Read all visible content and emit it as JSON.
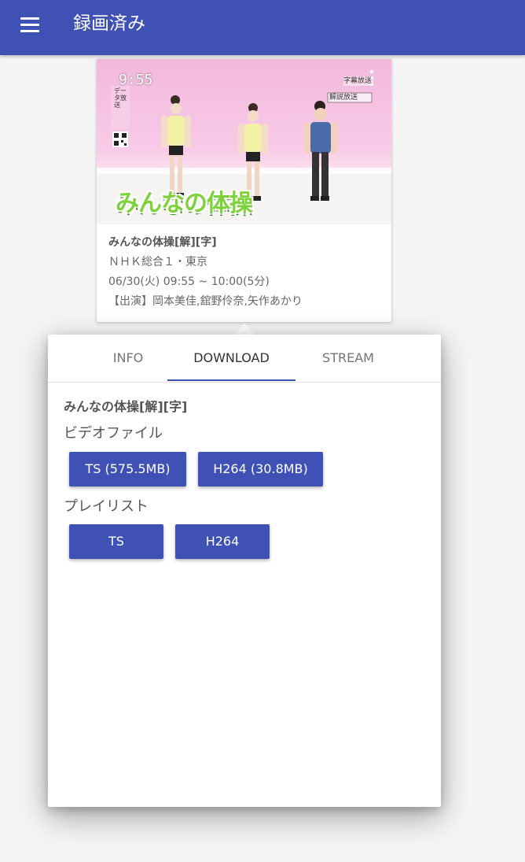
{
  "appbar": {
    "title": "録画済み",
    "menu_icon": "hamburger-menu-icon",
    "color": "#3f51b5"
  },
  "card": {
    "thumbnail": {
      "clock_text": "9:55",
      "logo_text": "みんなの体操",
      "badge_top": "字幕放送",
      "badge_bottom": "解説放送",
      "side_text": "データ放送"
    },
    "title": "みんなの体操[解][字]",
    "channel": "ＮＨＫ総合１・東京",
    "time": "06/30(火) 09:55 ~ 10:00(5分)",
    "cast": "【出演】岡本美佳,舘野伶奈,矢作あかり"
  },
  "dialog": {
    "tabs": [
      {
        "label": "INFO",
        "active": false
      },
      {
        "label": "DOWNLOAD",
        "active": true
      },
      {
        "label": "STREAM",
        "active": false
      }
    ],
    "title": "みんなの体操[解][字]",
    "video_section": {
      "label": "ビデオファイル",
      "buttons": [
        "TS (575.5MB)",
        "H264 (30.8MB)"
      ]
    },
    "playlist_section": {
      "label": "プレイリスト",
      "buttons": [
        "TS",
        "H264"
      ]
    },
    "accent_color": "#3f51b5"
  }
}
